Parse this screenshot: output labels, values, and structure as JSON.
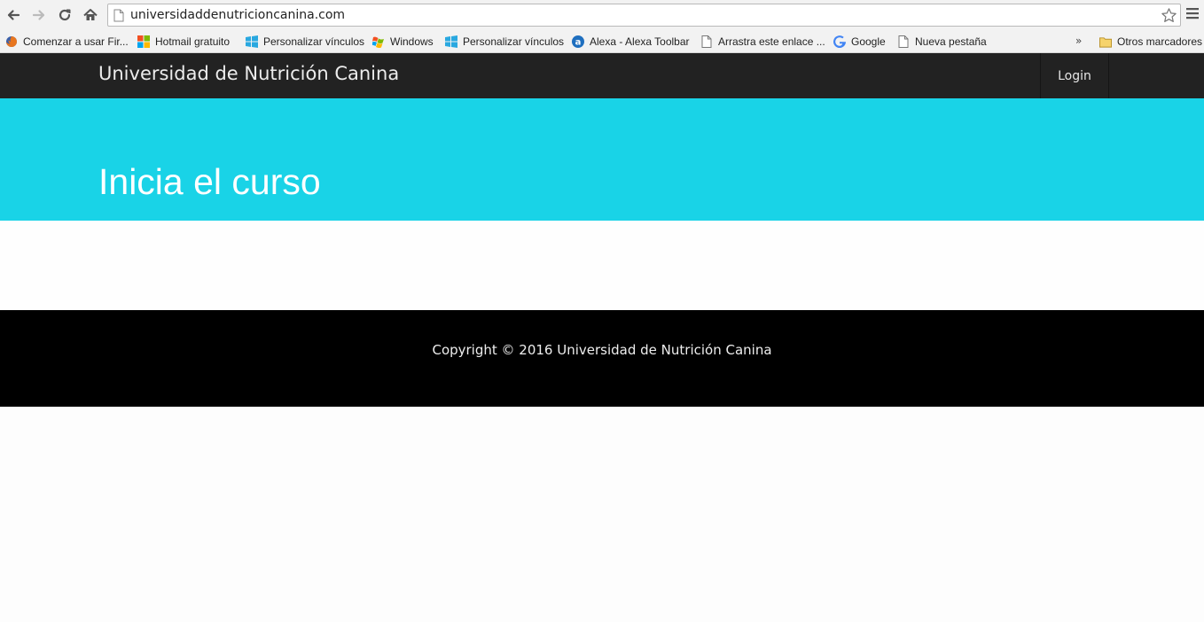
{
  "browser": {
    "url": "universidaddenutricioncanina.com",
    "bookmarks": [
      {
        "label": "Comenzar a usar Fir...",
        "icon": "firefox-icon"
      },
      {
        "label": "Hotmail gratuito",
        "icon": "microsoft-logo-icon"
      },
      {
        "label": "Personalizar vínculos",
        "icon": "windows-flag-icon"
      },
      {
        "label": "Windows",
        "icon": "windows-xp-flag-icon"
      },
      {
        "label": "Personalizar vínculos",
        "icon": "windows-flag-icon"
      },
      {
        "label": "Alexa - Alexa Toolbar",
        "icon": "alexa-icon"
      },
      {
        "label": "Arrastra este enlace ...",
        "icon": "page-icon"
      },
      {
        "label": "Google",
        "icon": "google-icon"
      },
      {
        "label": "Nueva pestaña",
        "icon": "page-icon"
      }
    ],
    "more_label": "»",
    "other_bookmarks": "Otros marcadores"
  },
  "site": {
    "brand": "Universidad de Nutrición Canina",
    "nav": {
      "login": "Login"
    },
    "hero": {
      "title": "Inicia el curso",
      "color": "#19d3e7"
    },
    "footer": {
      "copyright": "Copyright © 2016 Universidad de Nutrición Canina"
    }
  }
}
